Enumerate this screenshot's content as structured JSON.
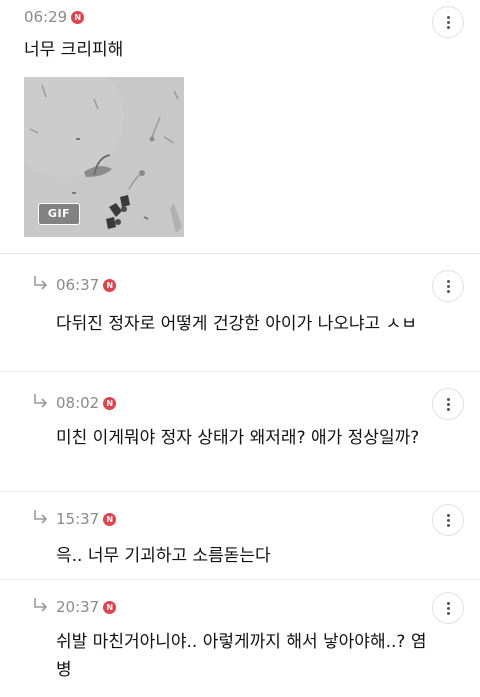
{
  "comments": [
    {
      "time": "06:29",
      "badge": "N",
      "text": "너무 크리피해",
      "attachment": {
        "type": "gif",
        "label": "GIF",
        "subject": "microscope-sperm-image"
      },
      "is_reply": false
    },
    {
      "time": "06:37",
      "badge": "N",
      "text": "다뒤진 정자로 어떻게 건강한 아이가 나오냐고 ㅅㅂ",
      "is_reply": true
    },
    {
      "time": "08:02",
      "badge": "N",
      "text": "미친 이게뭐야 정자 상태가 왜저래? 애가 정상일까?",
      "is_reply": true
    },
    {
      "time": "15:37",
      "badge": "N",
      "text": "윽.. 너무 기괴하고 소름돋는다",
      "is_reply": true
    },
    {
      "time": "20:37",
      "badge": "N",
      "text": "쉬발 마친거아니야.. 아렇게까지 해서 낳아야해..? 염병",
      "is_reply": true
    }
  ],
  "icons": {
    "more": "more-vertical-icon",
    "reply": "reply-arrow-icon",
    "new": "new-badge-icon"
  },
  "colors": {
    "badge": "#e0434b",
    "meta": "#8a8a8a",
    "divider": "#e6e6e6"
  }
}
